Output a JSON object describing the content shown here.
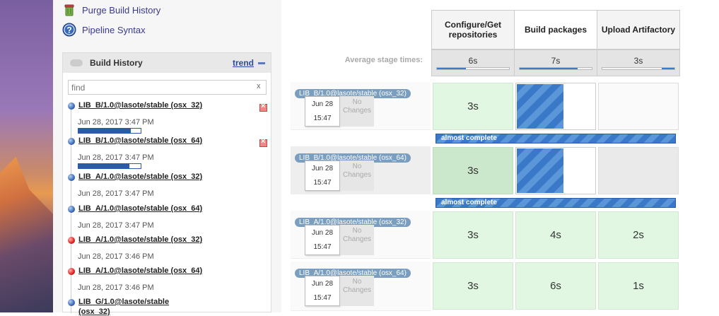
{
  "tasks": {
    "purge": "Purge Build History",
    "pipeline_syntax": "Pipeline Syntax"
  },
  "build_history": {
    "title": "Build History",
    "trend": "trend",
    "search_placeholder": "find",
    "search_clear": "x",
    "items": [
      {
        "name": "LIB_B/1.0@lasote/stable (osx_32)",
        "date": "Jun 28, 2017 3:47 PM",
        "status": "running",
        "progress": 0.84
      },
      {
        "name": "LIB_B/1.0@lasote/stable (osx_64)",
        "date": "Jun 28, 2017 3:47 PM",
        "status": "running",
        "progress": 0.82
      },
      {
        "name": "LIB_A/1.0@lasote/stable (osx_32)",
        "date": "Jun 28, 2017 3:47 PM",
        "status": "success"
      },
      {
        "name": "LIB_A/1.0@lasote/stable (osx_64)",
        "date": "Jun 28, 2017 3:47 PM",
        "status": "success"
      },
      {
        "name": "LIB_A/1.0@lasote/stable (osx_32)",
        "date": "Jun 28, 2017 3:46 PM",
        "status": "failed"
      },
      {
        "name": "LIB_A/1.0@lasote/stable (osx_64)",
        "date": "Jun 28, 2017 3:46 PM",
        "status": "failed"
      },
      {
        "name": "LIB_G/1.0@lasote/stable",
        "name2": "(osx_32)",
        "status": "success"
      }
    ]
  },
  "stage_view": {
    "avg_label": "Average stage times:",
    "stages": [
      {
        "name": "Configure/Get repositories",
        "avg": "6s",
        "avg_fraction": 0.4
      },
      {
        "name": "Build packages",
        "avg": "7s",
        "avg_fraction": 0.8
      },
      {
        "name": "Upload Artifactory",
        "avg": "3s",
        "avg_fraction": 0.18
      }
    ],
    "runs": [
      {
        "label": "LIB_B/1.0@lasote/stable (osx_32)",
        "date": "Jun 28",
        "time": "15:47",
        "changes": "No Changes",
        "cells": [
          "3s",
          "",
          ""
        ],
        "progress_label": "almost complete"
      },
      {
        "label": "LIB_B/1.0@lasote/stable (osx_64)",
        "date": "Jun 28",
        "time": "15:47",
        "changes": "No Changes",
        "cells": [
          "3s",
          "",
          ""
        ],
        "progress_label": "almost complete"
      },
      {
        "label": "LIB_A/1.0@lasote/stable (osx_32)",
        "date": "Jun 28",
        "time": "15:47",
        "changes": "No Changes",
        "cells": [
          "3s",
          "4s",
          "2s"
        ]
      },
      {
        "label": "LIB_A/1.0@lasote/stable (osx_64)",
        "date": "Jun 28",
        "time": "15:47",
        "changes": "No Changes",
        "cells": [
          "3s",
          "6s",
          "1s"
        ]
      }
    ]
  },
  "colors": {
    "link": "#3a3a8c",
    "success_cell": "#e2f7e2",
    "running_blue": "#3a78c8",
    "badge": "#7a9ec0"
  }
}
